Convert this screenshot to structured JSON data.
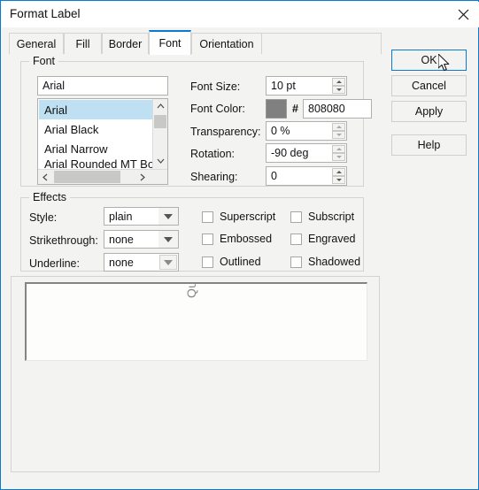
{
  "window": {
    "title": "Format Label",
    "close_icon": "close-icon"
  },
  "tabs": [
    {
      "label": "General",
      "active": false
    },
    {
      "label": "Fill",
      "active": false
    },
    {
      "label": "Border",
      "active": false
    },
    {
      "label": "Font",
      "active": true
    },
    {
      "label": "Orientation",
      "active": false
    }
  ],
  "font_group": {
    "legend": "Font",
    "font_name_value": "Arial",
    "list_items": [
      "Arial",
      "Arial Black",
      "Arial Narrow",
      "Arial Rounded MT Bold"
    ],
    "selected_item": "Arial",
    "scroll_up_icon": "chevron-up-icon",
    "scroll_down_icon": "chevron-down-icon",
    "scroll_left_icon": "chevron-left-icon",
    "scroll_right_icon": "chevron-right-icon"
  },
  "font_props": {
    "size_label": "Font Size:",
    "size_value": "10 pt",
    "color_label": "Font Color:",
    "color_hex_prefix": "#",
    "color_value": "808080",
    "color_swatch": "#808080",
    "transparency_label": "Transparency:",
    "transparency_value": "0 %",
    "rotation_label": "Rotation:",
    "rotation_value": "-90 deg",
    "shearing_label": "Shearing:",
    "shearing_value": "0"
  },
  "effects": {
    "legend": "Effects",
    "style_label": "Style:",
    "style_value": "plain",
    "strikethrough_label": "Strikethrough:",
    "strikethrough_value": "none",
    "underline_label": "Underline:",
    "underline_value": "none",
    "checkboxes": [
      {
        "label": "Superscript",
        "checked": false
      },
      {
        "label": "Subscript",
        "checked": false
      },
      {
        "label": "Embossed",
        "checked": false
      },
      {
        "label": "Engraved",
        "checked": false
      },
      {
        "label": "Outlined",
        "checked": false
      },
      {
        "label": "Shadowed",
        "checked": false
      }
    ]
  },
  "preview": {
    "sample_text": "Quantity"
  },
  "buttons": {
    "ok": "OK",
    "cancel": "Cancel",
    "apply": "Apply",
    "help": "Help"
  },
  "colors": {
    "accent": "#0b7ad1",
    "dialog_bg": "#f3f4f2",
    "selection": "#bfe0f3",
    "font_color": "#808080"
  }
}
